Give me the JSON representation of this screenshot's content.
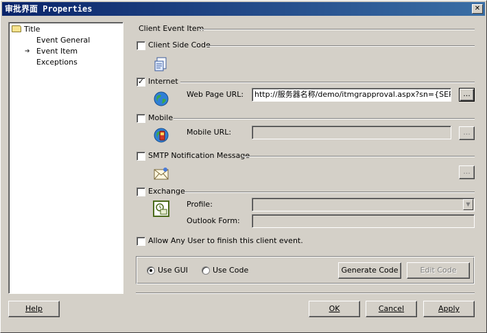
{
  "window": {
    "title": "审批界面 Properties",
    "close_glyph": "✕"
  },
  "tree": {
    "root_label": "Title",
    "items": [
      {
        "label": "Event General",
        "selected": false
      },
      {
        "label": "Event Item",
        "selected": true
      },
      {
        "label": "Exceptions",
        "selected": false
      }
    ],
    "selected_arrow": "➔"
  },
  "main": {
    "group_title": "Client Event Item",
    "client_side_code": {
      "label": "Client Side Code",
      "checked": false,
      "icon": "script-document-icon"
    },
    "internet": {
      "label": "Internet",
      "checked": true,
      "check_glyph": "✓",
      "icon": "globe-icon",
      "url_label": "Web Page URL:",
      "url_value": "http://服务器名称/demo/itmgrapproval.aspx?sn={SERIALNUM}",
      "browse_label": "..."
    },
    "mobile": {
      "label": "Mobile",
      "checked": false,
      "icon": "mobile-globe-icon",
      "url_label": "Mobile URL:",
      "url_value": "",
      "browse_label": "..."
    },
    "smtp": {
      "label": "SMTP Notification Message",
      "checked": false,
      "icon": "envelope-icon",
      "browse_label": "..."
    },
    "exchange": {
      "label": "Exchange",
      "checked": false,
      "icon": "exchange-icon",
      "profile_label": "Profile:",
      "profile_value": "",
      "combo_glyph": "▼",
      "outlook_form_label": "Outlook Form:",
      "outlook_form_value": ""
    },
    "allow_any_user": {
      "label": "Allow Any User to finish this client event.",
      "checked": false
    },
    "mode": {
      "use_gui_label": "Use GUI",
      "use_gui_selected": true,
      "use_code_label": "Use Code",
      "use_code_selected": false,
      "generate_code_label": "Generate Code",
      "edit_code_label": "Edit Code"
    }
  },
  "footer": {
    "help_label": "Help",
    "ok_label": "OK",
    "cancel_label": "Cancel",
    "apply_label": "Apply"
  },
  "colors": {
    "dialog_face": "#d4d0c8",
    "titlebar_start": "#0a246a",
    "titlebar_end": "#3a6ea5",
    "disabled_text": "#808080"
  }
}
